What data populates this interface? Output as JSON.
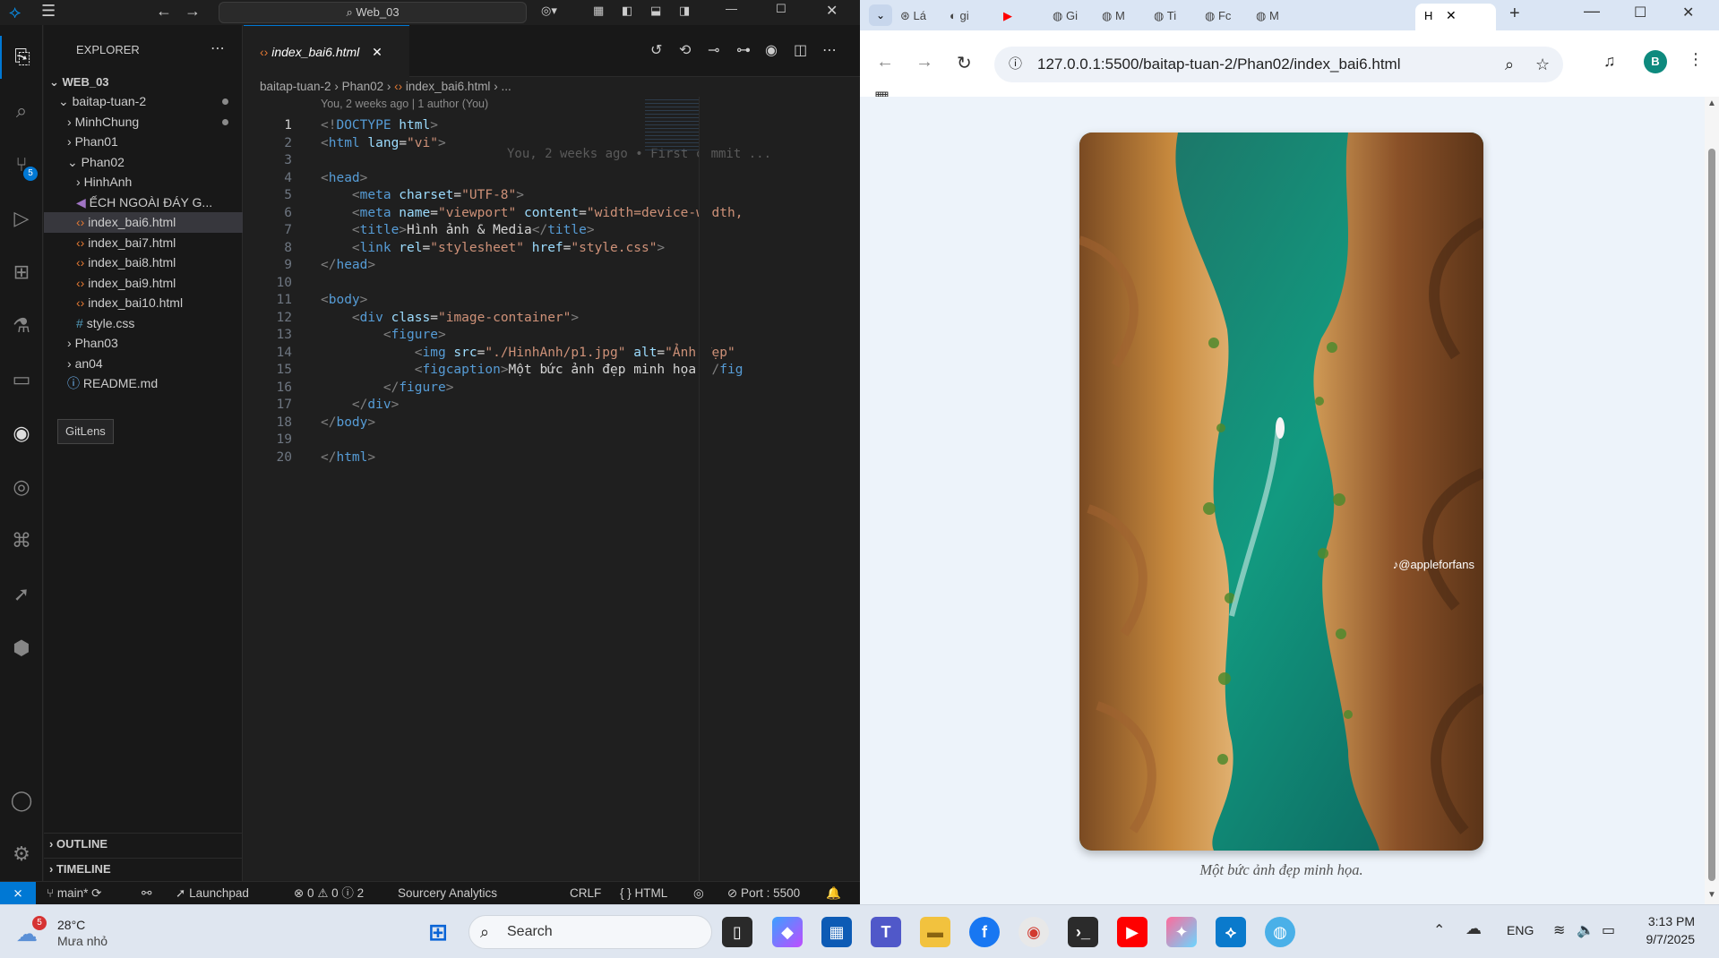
{
  "vscode": {
    "title_search": "Web_03",
    "explorer_title": "EXPLORER",
    "workspace": "WEB_03",
    "tree": [
      {
        "label": "baitap-tuan-2",
        "kind": "folder-open",
        "indent": 1,
        "dot": true
      },
      {
        "label": "MinhChung",
        "kind": "folder",
        "indent": 2,
        "dot": true
      },
      {
        "label": "Phan01",
        "kind": "folder",
        "indent": 2
      },
      {
        "label": "Phan02",
        "kind": "folder-open",
        "indent": 2
      },
      {
        "label": "HinhAnh",
        "kind": "folder",
        "indent": 3
      },
      {
        "label": "ẾCH NGOÀI ĐÁY G...",
        "kind": "audio",
        "indent": 3
      },
      {
        "label": "index_bai6.html",
        "kind": "html",
        "indent": 3,
        "selected": true
      },
      {
        "label": "index_bai7.html",
        "kind": "html",
        "indent": 3
      },
      {
        "label": "index_bai8.html",
        "kind": "html",
        "indent": 3
      },
      {
        "label": "index_bai9.html",
        "kind": "html",
        "indent": 3
      },
      {
        "label": "index_bai10.html",
        "kind": "html",
        "indent": 3
      },
      {
        "label": "style.css",
        "kind": "css",
        "indent": 3
      },
      {
        "label": "Phan03",
        "kind": "folder",
        "indent": 2
      },
      {
        "label": "an04",
        "kind": "folder",
        "indent": 2
      },
      {
        "label": "README.md",
        "kind": "info",
        "indent": 2
      }
    ],
    "tooltip": "GitLens",
    "outline": "OUTLINE",
    "timeline": "TIMELINE",
    "tab_label": "index_bai6.html",
    "breadcrumbs": [
      "baitap-tuan-2",
      "Phan02",
      "index_bai6.html",
      "..."
    ],
    "blame_header": "You, 2 weeks ago | 1 author (You)",
    "inline_blame": "You, 2 weeks ago • First commit ...",
    "scm_badge": "5",
    "code_lines": [
      {
        "n": "1",
        "parts": [
          [
            "punct",
            "<!"
          ],
          [
            "tag",
            "DOCTYPE"
          ],
          [
            "attr",
            " html"
          ],
          [
            "punct",
            ">"
          ]
        ]
      },
      {
        "n": "2",
        "parts": [
          [
            "punct",
            "<"
          ],
          [
            "tag",
            "html"
          ],
          [
            "attr",
            " lang"
          ],
          [
            "txt",
            "="
          ],
          [
            "str",
            "\"vi\""
          ],
          [
            "punct",
            ">"
          ]
        ]
      },
      {
        "n": "3",
        "parts": []
      },
      {
        "n": "4",
        "parts": [
          [
            "punct",
            "<"
          ],
          [
            "tag",
            "head"
          ],
          [
            "punct",
            ">"
          ]
        ]
      },
      {
        "n": "5",
        "parts": [
          [
            "txt",
            "    "
          ],
          [
            "punct",
            "<"
          ],
          [
            "tag",
            "meta"
          ],
          [
            "attr",
            " charset"
          ],
          [
            "txt",
            "="
          ],
          [
            "str",
            "\"UTF-8\""
          ],
          [
            "punct",
            ">"
          ]
        ]
      },
      {
        "n": "6",
        "parts": [
          [
            "txt",
            "    "
          ],
          [
            "punct",
            "<"
          ],
          [
            "tag",
            "meta"
          ],
          [
            "attr",
            " name"
          ],
          [
            "txt",
            "="
          ],
          [
            "str",
            "\"viewport\""
          ],
          [
            "attr",
            " content"
          ],
          [
            "txt",
            "="
          ],
          [
            "str",
            "\"width=device-width,"
          ]
        ]
      },
      {
        "n": "7",
        "parts": [
          [
            "txt",
            "    "
          ],
          [
            "punct",
            "<"
          ],
          [
            "tag",
            "title"
          ],
          [
            "punct",
            ">"
          ],
          [
            "txt",
            "Hình ảnh & Media"
          ],
          [
            "punct",
            "</"
          ],
          [
            "tag",
            "title"
          ],
          [
            "punct",
            ">"
          ]
        ]
      },
      {
        "n": "8",
        "parts": [
          [
            "txt",
            "    "
          ],
          [
            "punct",
            "<"
          ],
          [
            "tag",
            "link"
          ],
          [
            "attr",
            " rel"
          ],
          [
            "txt",
            "="
          ],
          [
            "str",
            "\"stylesheet\""
          ],
          [
            "attr",
            " href"
          ],
          [
            "txt",
            "="
          ],
          [
            "str",
            "\"style.css\""
          ],
          [
            "punct",
            ">"
          ]
        ]
      },
      {
        "n": "9",
        "parts": [
          [
            "punct",
            "</"
          ],
          [
            "tag",
            "head"
          ],
          [
            "punct",
            ">"
          ]
        ]
      },
      {
        "n": "10",
        "parts": []
      },
      {
        "n": "11",
        "parts": [
          [
            "punct",
            "<"
          ],
          [
            "tag",
            "body"
          ],
          [
            "punct",
            ">"
          ]
        ]
      },
      {
        "n": "12",
        "parts": [
          [
            "txt",
            "    "
          ],
          [
            "punct",
            "<"
          ],
          [
            "tag",
            "div"
          ],
          [
            "attr",
            " class"
          ],
          [
            "txt",
            "="
          ],
          [
            "str",
            "\"image-container\""
          ],
          [
            "punct",
            ">"
          ]
        ]
      },
      {
        "n": "13",
        "parts": [
          [
            "txt",
            "        "
          ],
          [
            "punct",
            "<"
          ],
          [
            "tag",
            "figure"
          ],
          [
            "punct",
            ">"
          ]
        ]
      },
      {
        "n": "14",
        "parts": [
          [
            "txt",
            "            "
          ],
          [
            "punct",
            "<"
          ],
          [
            "tag",
            "img"
          ],
          [
            "attr",
            " src"
          ],
          [
            "txt",
            "="
          ],
          [
            "str",
            "\"./HinhAnh/p1.jpg\""
          ],
          [
            "attr",
            " alt"
          ],
          [
            "txt",
            "="
          ],
          [
            "str",
            "\"Ảnh đẹp\""
          ]
        ]
      },
      {
        "n": "15",
        "parts": [
          [
            "txt",
            "            "
          ],
          [
            "punct",
            "<"
          ],
          [
            "tag",
            "figcaption"
          ],
          [
            "punct",
            ">"
          ],
          [
            "txt",
            "Một bức ảnh đẹp minh họa."
          ],
          [
            "punct",
            "</"
          ],
          [
            "tag",
            "fig"
          ]
        ]
      },
      {
        "n": "16",
        "parts": [
          [
            "txt",
            "        "
          ],
          [
            "punct",
            "</"
          ],
          [
            "tag",
            "figure"
          ],
          [
            "punct",
            ">"
          ]
        ]
      },
      {
        "n": "17",
        "parts": [
          [
            "txt",
            "    "
          ],
          [
            "punct",
            "</"
          ],
          [
            "tag",
            "div"
          ],
          [
            "punct",
            ">"
          ]
        ]
      },
      {
        "n": "18",
        "parts": [
          [
            "punct",
            "</"
          ],
          [
            "tag",
            "body"
          ],
          [
            "punct",
            ">"
          ]
        ]
      },
      {
        "n": "19",
        "parts": []
      },
      {
        "n": "20",
        "parts": [
          [
            "punct",
            "</"
          ],
          [
            "tag",
            "html"
          ],
          [
            "punct",
            ">"
          ]
        ]
      }
    ],
    "status": {
      "branch": "main*",
      "launchpad": "Launchpad",
      "problems": "⊗ 0 ⚠ 0 ⓘ 2",
      "sourcery": "Sourcery Analytics",
      "eol": "CRLF",
      "language": "{ } HTML",
      "port": "⊘ Port : 5500"
    }
  },
  "chrome": {
    "tabs": [
      "Lá",
      "gi",
      "",
      "Gi",
      "M",
      "Ti",
      "Fc",
      "M",
      "H"
    ],
    "url": "127.0.0.1:5500/baitap-tuan-2/Phan02/index_bai6.html",
    "profile_initial": "B",
    "photo_watermark": "♪@appleforfans",
    "caption": "Một bức ảnh đẹp minh họa."
  },
  "taskbar": {
    "weather_temp": "28°C",
    "weather_desc": "Mưa nhỏ",
    "weather_badge": "5",
    "search_placeholder": "Search",
    "lang": "ENG",
    "time": "3:13 PM",
    "date": "9/7/2025"
  },
  "colors": {
    "vscode_accent": "#0078d4",
    "remote_button": "#0078d4",
    "chrome_bg": "#dae5f4"
  }
}
